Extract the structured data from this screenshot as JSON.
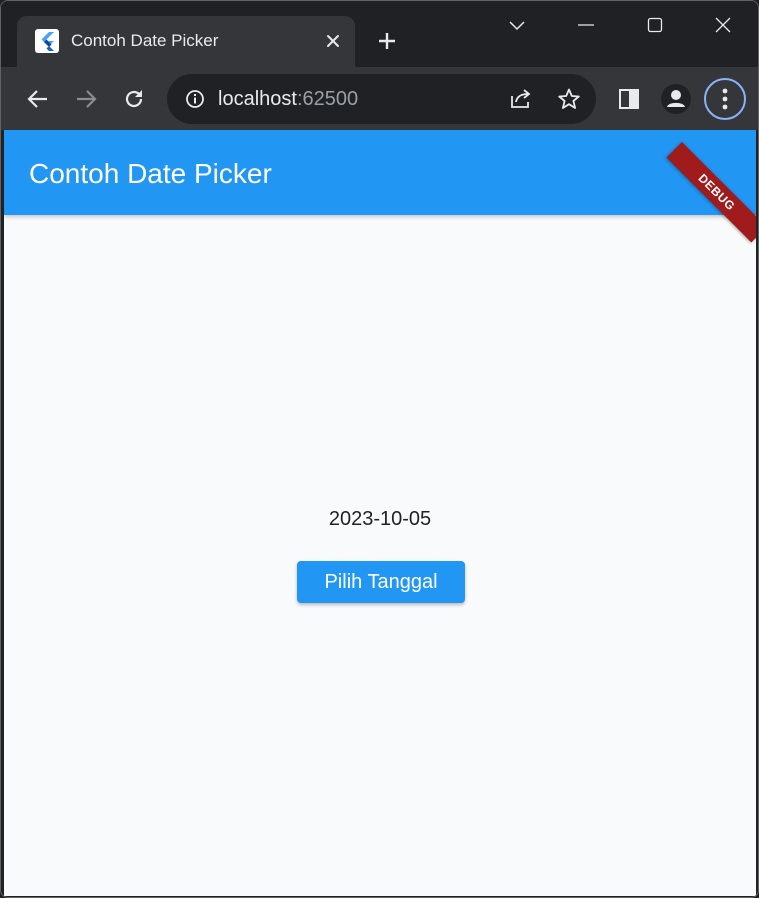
{
  "browser": {
    "tab": {
      "title": "Contoh Date Picker",
      "favicon": "flutter-logo"
    },
    "address_bar": {
      "host": "localhost",
      "port": ":62500"
    },
    "icons": {
      "back": "arrow-left-icon",
      "forward": "arrow-right-icon",
      "reload": "reload-icon",
      "site_info": "info-icon",
      "share": "share-icon",
      "bookmark": "star-icon",
      "side_panel": "side-panel-icon",
      "profile": "profile-icon",
      "menu": "kebab-menu-icon"
    },
    "colors": {
      "frame": "#202124",
      "toolbar": "#35363a",
      "accent_ring": "#8ab4f8"
    }
  },
  "app": {
    "appbar_title": "Contoh Date Picker",
    "debug_banner": "DEBUG",
    "selected_date": "2023-10-05",
    "pick_button_label": "Pilih Tanggal",
    "colors": {
      "primary": "#2196f3",
      "background": "#f9fafc",
      "banner": "#a01b1b"
    }
  }
}
